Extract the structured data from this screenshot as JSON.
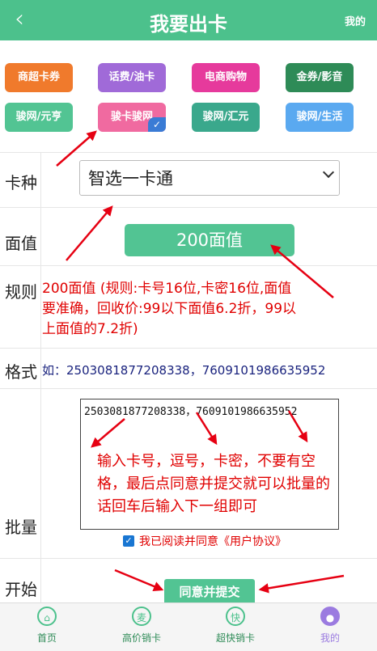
{
  "header": {
    "back": "‹",
    "title": "我要出卡",
    "right": "我的"
  },
  "categories": [
    {
      "label": "商超卡券",
      "color": "#f07a2c",
      "selected": false
    },
    {
      "label": "话费/油卡",
      "color": "#a06ad8",
      "selected": false
    },
    {
      "label": "电商购物",
      "color": "#e63a9c",
      "selected": false
    },
    {
      "label": "金券/影音",
      "color": "#2e8b57",
      "selected": false
    },
    {
      "label": "骏网/元亨",
      "color": "#52c493",
      "selected": false
    },
    {
      "label": "骏卡骏网",
      "color": "#f06aa0",
      "selected": true
    },
    {
      "label": "骏网/汇元",
      "color": "#3aa88c",
      "selected": false
    },
    {
      "label": "骏网/生活",
      "color": "#5aa9f0",
      "selected": false
    }
  ],
  "form": {
    "kind_label": "卡种",
    "kind_value": "智选一卡通",
    "value_label": "面值",
    "value_button": "200面值",
    "rule_label": "规则",
    "rule_text": "200面值 (规则:卡号16位,卡密16位,面值要准确，回收价:99以下面值6.2折，99以上面值的7.2折)",
    "format_label": "格式",
    "format_text": "如：2503081877208338，7609101986635952",
    "batch_label": "批量",
    "batch_value": "2503081877208338，7609101986635952",
    "batch_hint": "输入卡号，逗号，卡密，不要有空格，最后点同意并提交就可以批量的话回车后输入下一组即可",
    "agree_text": "我已阅读并同意《用户协议》",
    "agree_checked": true,
    "start_label": "开始",
    "submit": "同意并提交"
  },
  "tabbar": [
    {
      "label": "首页",
      "icon": "home-icon",
      "glyph": "⌂",
      "color": "#4cc18c",
      "active": true
    },
    {
      "label": "高价销卡",
      "icon": "sell-icon",
      "glyph": "麦",
      "color": "#4cc18c",
      "active": true
    },
    {
      "label": "超快销卡",
      "icon": "fast-icon",
      "glyph": "快",
      "color": "#4cc18c",
      "active": true
    },
    {
      "label": "我的",
      "icon": "profile-icon",
      "glyph": "●",
      "color": "#9b7be0",
      "active": false
    }
  ]
}
